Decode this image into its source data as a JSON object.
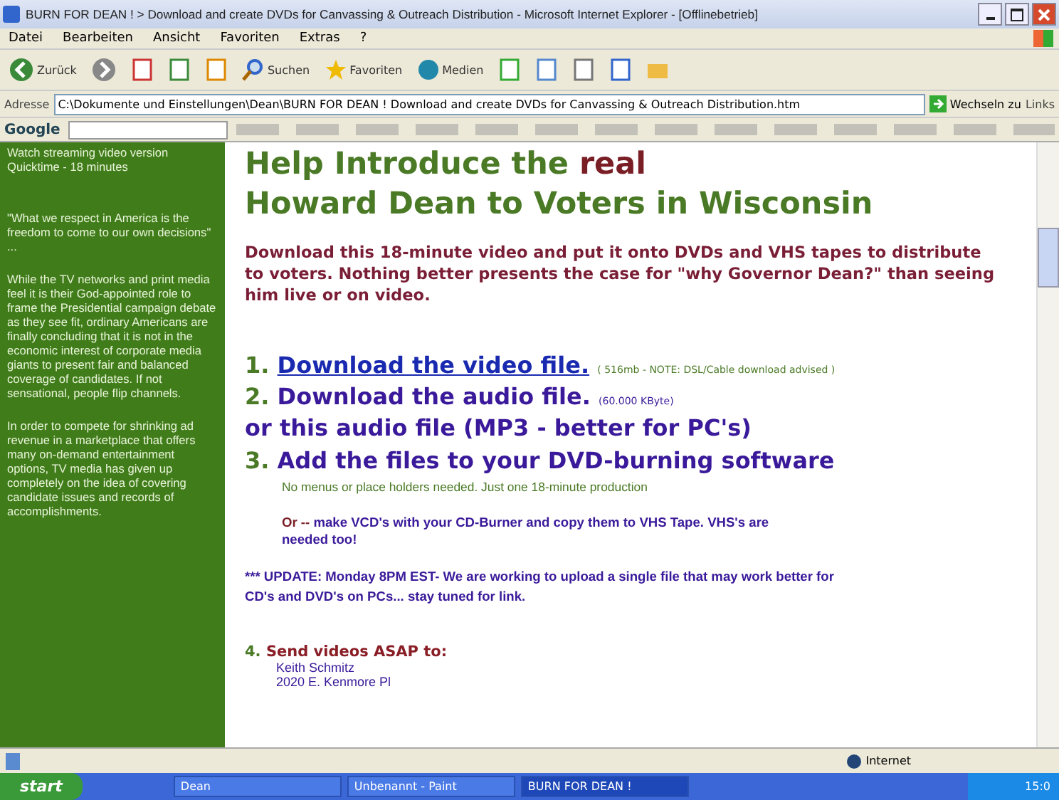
{
  "window": {
    "title": "BURN FOR DEAN ! > Download and create DVDs for Canvassing & Outreach Distribution - Microsoft Internet Explorer - [Offlinebetrieb]"
  },
  "menu": [
    "Datei",
    "Bearbeiten",
    "Ansicht",
    "Favoriten",
    "Extras",
    "?"
  ],
  "toolbar": [
    {
      "kind": "back",
      "label": "Zurück"
    },
    {
      "kind": "forward"
    },
    {
      "kind": "stop"
    },
    {
      "kind": "refresh"
    },
    {
      "kind": "home"
    },
    {
      "kind": "search",
      "label": "Suchen"
    },
    {
      "kind": "favorites",
      "label": "Favoriten"
    },
    {
      "kind": "media",
      "label": "Medien"
    },
    {
      "kind": "history"
    },
    {
      "kind": "mail"
    },
    {
      "kind": "print"
    },
    {
      "kind": "edit"
    },
    {
      "kind": "folder"
    }
  ],
  "address": {
    "label": "Adresse",
    "value": "C:\\Dokumente und Einstellungen\\Dean\\BURN FOR DEAN ! Download and create DVDs for Canvassing & Outreach Distribution.htm",
    "go": "Wechseln zu",
    "links": "Links"
  },
  "search_bar": {
    "brand": "Google"
  },
  "sidebar": [
    "Watch streaming video version Quicktime - 18 minutes",
    "\"What we respect in America is the freedom to come to our own decisions\" ...",
    "While the TV networks and print media feel it is their God-appointed role to frame the Presidential campaign debate as they see fit, ordinary Americans are finally concluding that it is not in the economic interest of corporate media giants to present fair and balanced coverage of candidates. If not sensational, people flip channels.",
    "In order to compete for shrinking ad revenue in a marketplace that offers many on-demand entertainment options, TV media has given up completely on the idea of covering candidate issues and records of accomplishments."
  ],
  "content": {
    "heading": "Help Introduce the **real**",
    "heading_line_2": "Howard Dean to Voters in Wisconsin",
    "intro": "Download this 18-minute video and put it onto DVDs and VHS tapes to distribute to voters. Nothing better presents the case for \"why Governor Dean?\" than seeing him live or on video.",
    "steps": [
      {
        "kind": "link",
        "number": "1.",
        "text": "Download the video file.",
        "note": "( 516mb - NOTE: DSL/Cable download advised )"
      },
      {
        "kind": "plain",
        "number": "2.",
        "text": "Download the audio file.",
        "note": "(60.000 KByte)"
      },
      {
        "kind": "sub",
        "text": "or this audio file (MP3 - better for PC's)"
      },
      {
        "kind": "plain",
        "number": "3.",
        "text": "Add the files to your DVD-burning software"
      }
    ],
    "hint": "No menus or place holders needed. Just one 18-minute production",
    "or_prefix": "Or --",
    "or_text": "make VCD's with your CD-Burner and copy them to VHS Tape. VHS's are needed too!",
    "update": "*** UPDATE: Monday 8PM EST- We are working to upload a single file that may work better for CD's and DVD's on PCs... stay tuned for link.",
    "step_4": {
      "number": "4.",
      "text": "Send videos ASAP to:"
    },
    "address_lines": [
      "Keith Schmitz",
      "2020 E. Kenmore Pl"
    ]
  },
  "status_bar": {
    "zone": "Internet"
  },
  "taskbar": {
    "start": "start",
    "tasks": [
      {
        "label": "Dean",
        "selected": false
      },
      {
        "label": "Unbenannt - Paint",
        "selected": false
      },
      {
        "label": "BURN FOR DEAN !",
        "selected": true
      }
    ],
    "clock": "15:0"
  }
}
